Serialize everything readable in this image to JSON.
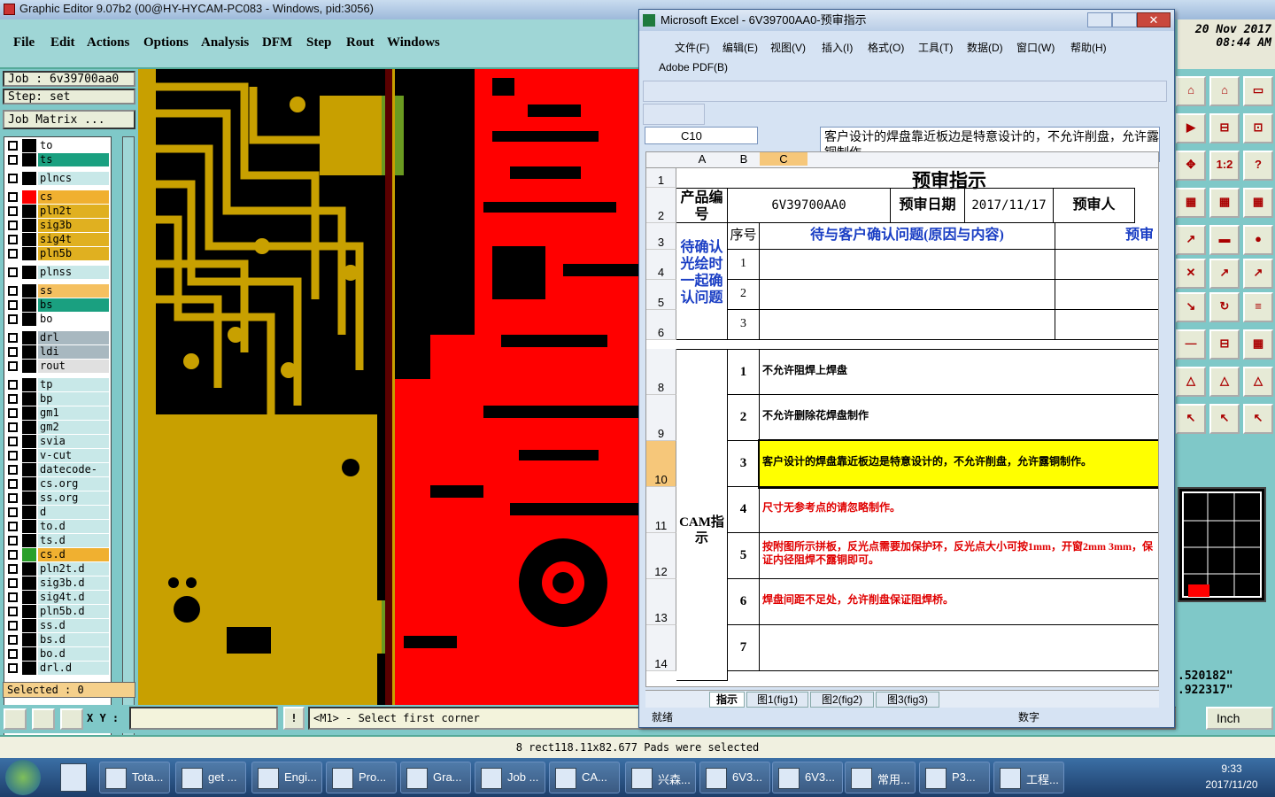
{
  "ge": {
    "title": "Graphic Editor 9.07b2 (00@HY-HYCAM-PC083 - Windows, pid:3056)",
    "menu": [
      "File",
      "Edit",
      "Actions",
      "Options",
      "Analysis",
      "DFM",
      "Step",
      "Rout",
      "Windows"
    ],
    "job": "Job : 6v39700aa0",
    "step": "Step: set",
    "job_matrix": "Job Matrix ...",
    "date": "20 Nov 2017",
    "time": "08:44 AM",
    "selected": "Selected : 0",
    "xy_label": "X Y :",
    "prompt": "<M1> - Select first corner",
    "status": "8 rect118.11x82.677 Pads were selected",
    "coord1": ".520182\"",
    "coord2": ".922317\"",
    "units": "Inch",
    "layers": [
      {
        "n": "to",
        "c": "#ffffff"
      },
      {
        "n": "ts",
        "c": "#1aa080"
      },
      {
        "n": "plncs",
        "c": "#c8e8e8"
      },
      {
        "n": "cs",
        "c": "#f0b030"
      },
      {
        "n": "pln2t",
        "c": "#e0b020"
      },
      {
        "n": "sig3b",
        "c": "#e0b020"
      },
      {
        "n": "sig4t",
        "c": "#e0b020"
      },
      {
        "n": "pln5b",
        "c": "#e0b020"
      },
      {
        "n": "plnss",
        "c": "#c8e8e8"
      },
      {
        "n": "ss",
        "c": "#f5c060"
      },
      {
        "n": "bs",
        "c": "#1aa080"
      },
      {
        "n": "bo",
        "c": "#ffffff"
      },
      {
        "n": "drl",
        "c": "#a8b8c0"
      },
      {
        "n": "ldi",
        "c": "#a8b8c0"
      },
      {
        "n": "rout",
        "c": "#e0e0e0"
      },
      {
        "n": "tp",
        "c": "#c8e8e8"
      },
      {
        "n": "bp",
        "c": "#c8e8e8"
      },
      {
        "n": "gm1",
        "c": "#c8e8e8"
      },
      {
        "n": "gm2",
        "c": "#c8e8e8"
      },
      {
        "n": "svia",
        "c": "#c8e8e8"
      },
      {
        "n": "v-cut",
        "c": "#c8e8e8"
      },
      {
        "n": "datecode-bo",
        "c": "#c8e8e8"
      },
      {
        "n": "cs.org",
        "c": "#c8e8e8"
      },
      {
        "n": "ss.org",
        "c": "#c8e8e8"
      },
      {
        "n": "d",
        "c": "#c8e8e8"
      },
      {
        "n": "to.d",
        "c": "#c8e8e8"
      },
      {
        "n": "ts.d",
        "c": "#c8e8e8"
      },
      {
        "n": "cs.d",
        "c": "#f0b030"
      },
      {
        "n": "pln2t.d",
        "c": "#c8e8e8"
      },
      {
        "n": "sig3b.d",
        "c": "#c8e8e8"
      },
      {
        "n": "sig4t.d",
        "c": "#c8e8e8"
      },
      {
        "n": "pln5b.d",
        "c": "#c8e8e8"
      },
      {
        "n": "ss.d",
        "c": "#c8e8e8"
      },
      {
        "n": "bs.d",
        "c": "#c8e8e8"
      },
      {
        "n": "bo.d",
        "c": "#c8e8e8"
      },
      {
        "n": "drl.d",
        "c": "#c8e8e8"
      }
    ]
  },
  "excel": {
    "title": "Microsoft Excel - 6V39700AA0-预审指示",
    "menu": [
      "文件(F)",
      "编辑(E)",
      "视图(V)",
      "插入(I)",
      "格式(O)",
      "工具(T)",
      "数据(D)",
      "窗口(W)",
      "帮助(H)"
    ],
    "pdf_menu": "Adobe PDF(B)",
    "namebox": "C10",
    "formula": "客户设计的焊盘靠近板边是特意设计的，不允许削盘，允许露铜制作。",
    "cols": [
      "A",
      "B",
      "C"
    ],
    "sheet_title": "预审指示",
    "product_label": "产品编号",
    "product_no": "6V39700AA0",
    "date_label": "预审日期",
    "date": "2017/11/17",
    "reviewer_label": "预审人",
    "seq_label": "序号",
    "issue_header": "待与客户确认问题(原因与内容)",
    "right_header": "预审",
    "confirm_label": "待确认光绘时一起确认问题",
    "cam_label": "CAM指示",
    "issue_rows": [
      "1",
      "2",
      "3"
    ],
    "cam_rows": [
      {
        "n": "1",
        "t": "不允许阻焊上焊盘",
        "red": false
      },
      {
        "n": "2",
        "t": "不允许删除花焊盘制作",
        "red": false
      },
      {
        "n": "3",
        "t": "客户设计的焊盘靠近板边是特意设计的，不允许削盘，允许露铜制作。",
        "red": false,
        "hl": true
      },
      {
        "n": "4",
        "t": "尺寸无参考点的请忽略制作。",
        "red": true
      },
      {
        "n": "5",
        "t": "按附图所示拼板，反光点需要加保护环，反光点大小可按1mm，开窗2mm 3mm，保证内径阻焊不露铜即可。",
        "red": true
      },
      {
        "n": "6",
        "t": "焊盘间距不足处，允许削盘保证阻焊桥。",
        "red": true
      },
      {
        "n": "7",
        "t": "",
        "red": false
      }
    ],
    "row_heads": [
      "1",
      "2",
      "3",
      "4",
      "5",
      "6",
      "8",
      "9",
      "10",
      "11",
      "12",
      "13",
      "14"
    ],
    "tabs": [
      "指示",
      "图1(fig1)",
      "图2(fig2)",
      "图3(fig3)"
    ],
    "status_ready": "就绪",
    "status_num": "数字"
  },
  "taskbar": {
    "items": [
      "Tota...",
      "get ...",
      "Engi...",
      "Pro...",
      "Gra...",
      "Job ...",
      "CA...",
      "兴森...",
      "6V3...",
      "6V3...",
      "常用...",
      "P3...",
      "工程..."
    ],
    "time": "9:33",
    "date": "2017/11/20"
  },
  "colors": {
    "red": "#ff0000",
    "gold": "#c8a000",
    "teal": "#7fc8c8"
  }
}
